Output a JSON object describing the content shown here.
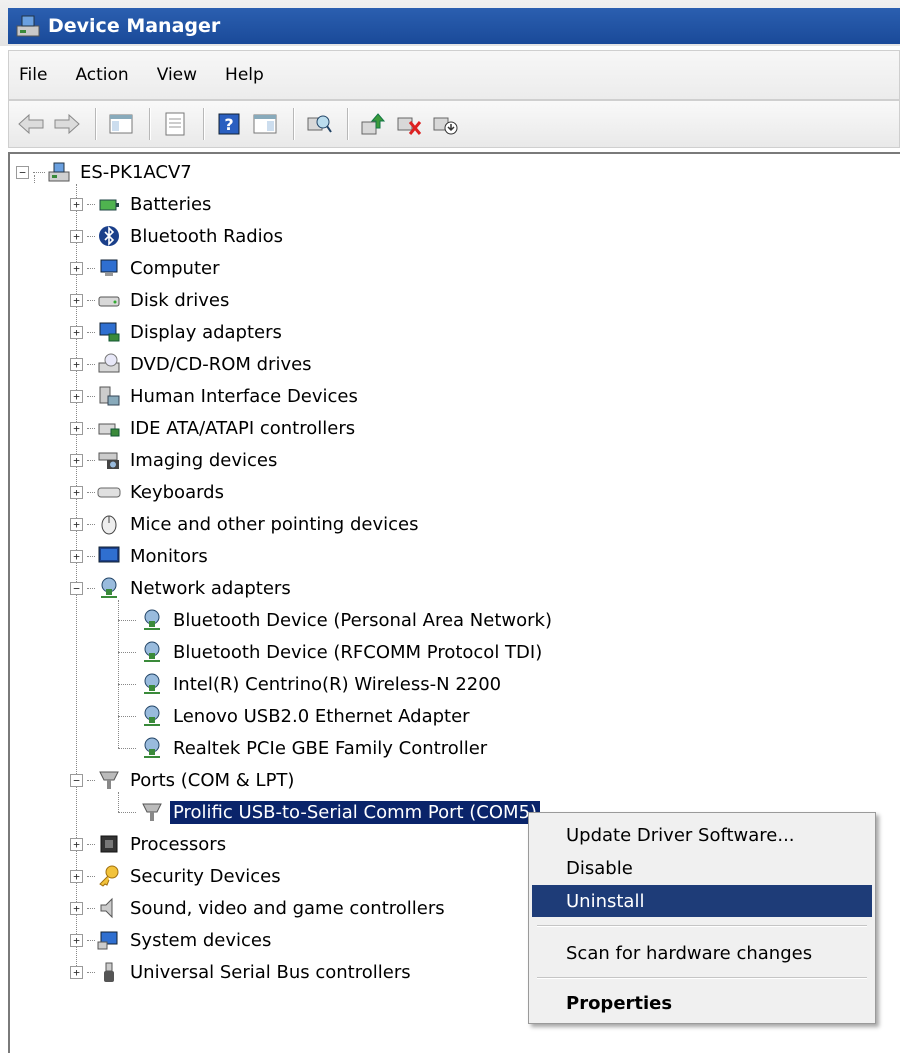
{
  "window": {
    "title": "Device Manager"
  },
  "menu": [
    "File",
    "Action",
    "View",
    "Help"
  ],
  "toolbar": {
    "buttons": [
      "back-icon",
      "forward-icon",
      "show-hide-console-tree-icon",
      "properties-icon",
      "help-icon",
      "show-action-pane-icon",
      "scan-hardware-icon",
      "update-driver-icon",
      "uninstall-device-icon",
      "disable-device-icon"
    ]
  },
  "tree": {
    "root": "ES-PK1ACV7",
    "categories": [
      {
        "label": "Batteries",
        "icon": "battery-icon"
      },
      {
        "label": "Bluetooth Radios",
        "icon": "bluetooth-icon"
      },
      {
        "label": "Computer",
        "icon": "computer-icon"
      },
      {
        "label": "Disk drives",
        "icon": "disk-drive-icon"
      },
      {
        "label": "Display adapters",
        "icon": "display-adapter-icon"
      },
      {
        "label": "DVD/CD-ROM drives",
        "icon": "dvd-drive-icon"
      },
      {
        "label": "Human Interface Devices",
        "icon": "hid-icon"
      },
      {
        "label": "IDE ATA/ATAPI controllers",
        "icon": "ide-controller-icon"
      },
      {
        "label": "Imaging devices",
        "icon": "camera-icon"
      },
      {
        "label": "Keyboards",
        "icon": "keyboard-icon"
      },
      {
        "label": "Mice and other pointing devices",
        "icon": "mouse-icon"
      },
      {
        "label": "Monitors",
        "icon": "monitor-icon"
      },
      {
        "label": "Network adapters",
        "icon": "network-adapter-icon",
        "expanded": true,
        "children": [
          "Bluetooth Device (Personal Area Network)",
          "Bluetooth Device (RFCOMM Protocol TDI)",
          "Intel(R) Centrino(R) Wireless-N 2200",
          "Lenovo USB2.0 Ethernet Adapter",
          "Realtek PCIe GBE Family Controller"
        ]
      },
      {
        "label": "Ports (COM & LPT)",
        "icon": "port-icon",
        "expanded": true,
        "children": [
          "Prolific USB-to-Serial Comm Port (COM5)"
        ]
      },
      {
        "label": "Processors",
        "icon": "processor-icon"
      },
      {
        "label": "Security Devices",
        "icon": "key-icon"
      },
      {
        "label": "Sound, video and game controllers",
        "icon": "speaker-icon"
      },
      {
        "label": "System devices",
        "icon": "system-device-icon"
      },
      {
        "label": "Universal Serial Bus controllers",
        "icon": "usb-icon"
      }
    ]
  },
  "context_menu": {
    "items": [
      "Update Driver Software...",
      "Disable",
      "Uninstall",
      "Scan for hardware changes",
      "Properties"
    ],
    "highlighted": "Uninstall"
  },
  "colors": {
    "title_bar": "#1a4a99",
    "selection": "#0a246a",
    "menu_highlight": "#1e3c78"
  }
}
